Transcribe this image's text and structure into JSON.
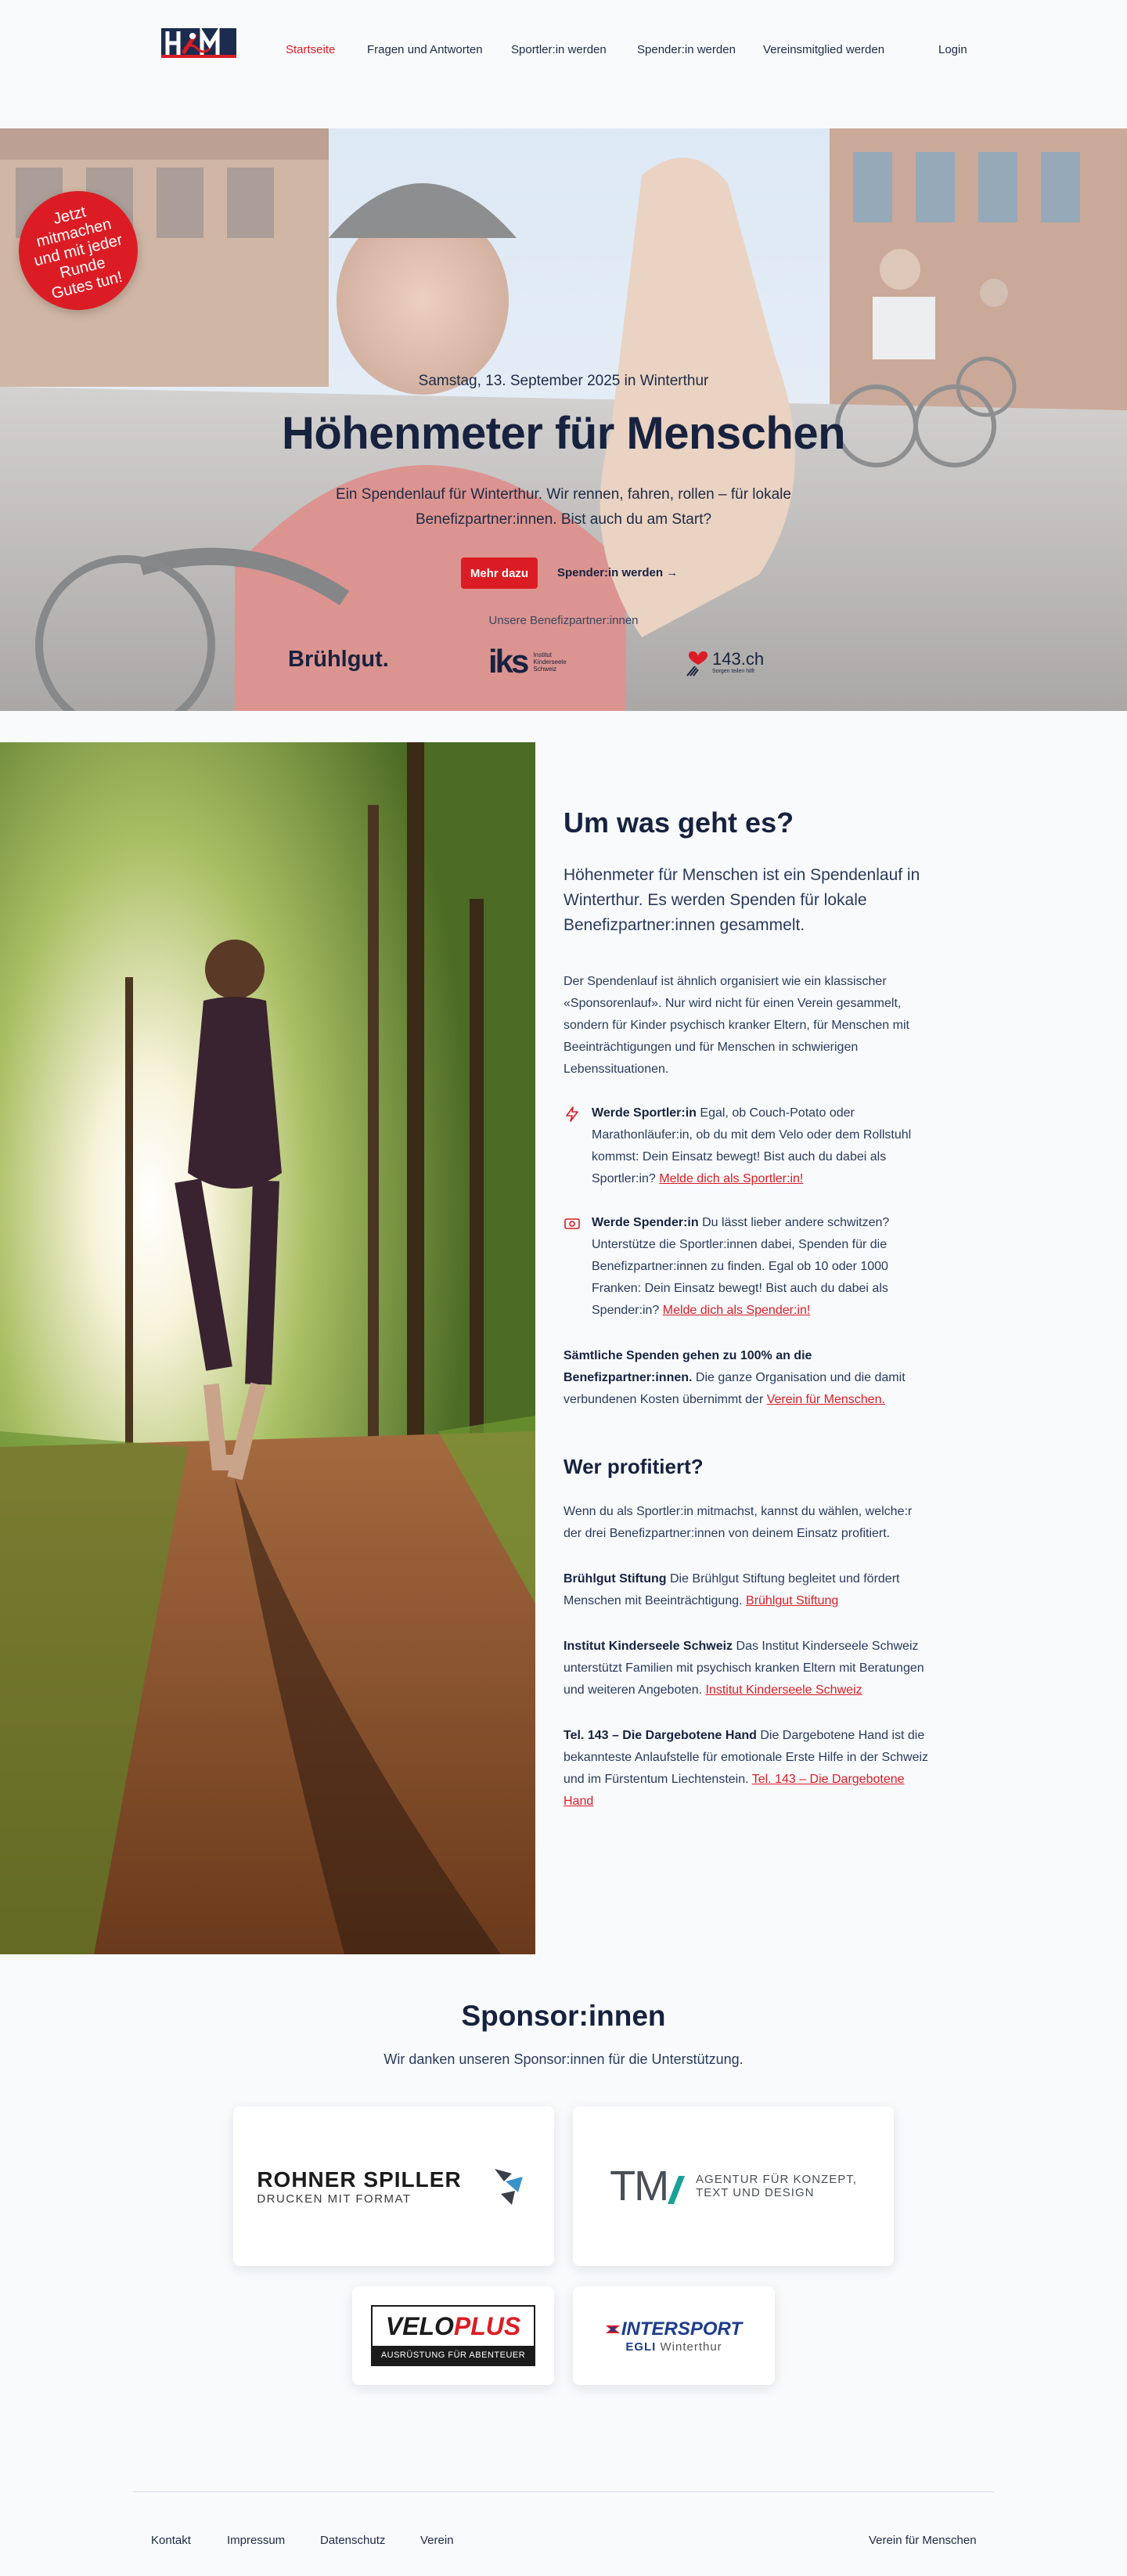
{
  "nav": {
    "items": [
      {
        "label": "Startseite",
        "active": true
      },
      {
        "label": "Fragen und Antworten"
      },
      {
        "label": "Sportler:in werden"
      },
      {
        "label": "Spender:in werden"
      },
      {
        "label": "Vereinsmitglied werden"
      },
      {
        "label": "Login"
      }
    ]
  },
  "hero": {
    "badge": "Jetzt mitmachen und mit jeder Runde Gutes tun!",
    "date": "Samstag, 13. September 2025 in Winterthur",
    "title": "Höhenmeter für Menschen",
    "lead": "Ein Spendenlauf für Winterthur. Wir rennen, fahren, rollen – für lokale Benefizpartner:innen. Bist auch du am Start?",
    "primary_button": "Mehr dazu",
    "secondary_button": "Spender:in werden →",
    "partners_label": "Unsere Benefizpartner:innen",
    "partners": {
      "bruehlgut": "Brühlgut.",
      "iks_mark": "iks",
      "iks_text": [
        "Institut",
        "Kinderseele",
        "Schweiz"
      ],
      "tel143": "143.ch",
      "tel143_sub": "Sorgen teilen hilft"
    }
  },
  "about": {
    "title": "Um was geht es?",
    "lead": "Höhenmeter für Menschen ist ein Spendenlauf in Winterthur. Es werden Spenden für lokale Benefizpartner:innen gesammelt.",
    "intro": "Der Spendenlauf ist ähnlich organisiert wie ein klassischer «Sponsorenlauf». Nur wird nicht für einen Verein gesammelt, sondern für Kinder psychisch kranker Eltern, für Menschen mit Beeinträchtigungen und für Menschen in schwierigen Lebenssituationen.",
    "features": [
      {
        "icon": "lightning-icon",
        "title": "Werde Sportler:in",
        "text": " Egal, ob Couch-Potato oder Marathonläufer:in, ob du mit dem Velo oder dem Rollstuhl kommst: Dein Einsatz bewegt! Bist auch du dabei als Sportler:in? ",
        "link": "Melde dich als Sportler:in!"
      },
      {
        "icon": "money-icon",
        "title": "Werde Spender:in",
        "text": " Du lässt lieber andere schwitzen? Unterstütze die Sportler:innen dabei, Spenden für die Benefizpartner:innen zu finden. Egal ob 10 oder 1000 Franken: Dein Einsatz bewegt! Bist auch du dabei als Spender:in? ",
        "link": "Melde dich als Spender:in!"
      }
    ],
    "donation_bold": "Sämtliche Spenden gehen zu 100% an die Benefizpartner:innen.",
    "donation_text": " Die ganze Organisation und die damit verbundenen Kosten übernimmt der ",
    "donation_link": "Verein für Menschen."
  },
  "benefit": {
    "title": "Wer profitiert?",
    "intro": "Wenn du als Sportler:in mitmachst, kannst du wählen, welche:r der drei Benefizpartner:innen von deinem Einsatz profitiert.",
    "partners": [
      {
        "name": "Brühlgut Stiftung",
        "text": " Die Brühlgut Stiftung begleitet und fördert Menschen mit Beeinträchtigung. ",
        "link": "Brühlgut Stiftung"
      },
      {
        "name": "Institut Kinderseele Schweiz",
        "text": " Das Institut Kinderseele Schweiz unterstützt Familien mit psychisch kranken Eltern mit Beratungen und weiteren Angeboten. ",
        "link": "Institut Kinderseele Schweiz"
      },
      {
        "name": "Tel. 143 – Die Dargebotene Hand",
        "text": " Die Dargebotene Hand ist die bekannteste Anlaufstelle für emotionale Erste Hilfe in der Schweiz und im Fürstentum Liechtenstein. ",
        "link": "Tel. 143 – Die Dargebotene Hand"
      }
    ]
  },
  "sponsors": {
    "title": "Sponsor:innen",
    "subtitle": "Wir danken unseren Sponsor:innen für die Unterstützung.",
    "rohner": {
      "name": "ROHNER SPILLER",
      "tagline": "DRUCKEN MIT FORMAT"
    },
    "tm": {
      "mark": "TM",
      "line1": "AGENTUR FÜR KONZEPT,",
      "line2": "TEXT UND DESIGN"
    },
    "veloplus": {
      "velo": "VELO",
      "plus": "PLUS",
      "tagline": "AUSRÜSTUNG FÜR ABENTEUER"
    },
    "intersport": {
      "name": "INTERSPORT",
      "sub_bold": "EGLI",
      "sub": " Winterthur"
    }
  },
  "footer": {
    "links": [
      "Kontakt",
      "Impressum",
      "Datenschutz",
      "Verein"
    ],
    "right": "Verein für Menschen"
  },
  "colors": {
    "accent": "#dc1c24",
    "navy": "#17223f",
    "background": "#f8fafc"
  }
}
